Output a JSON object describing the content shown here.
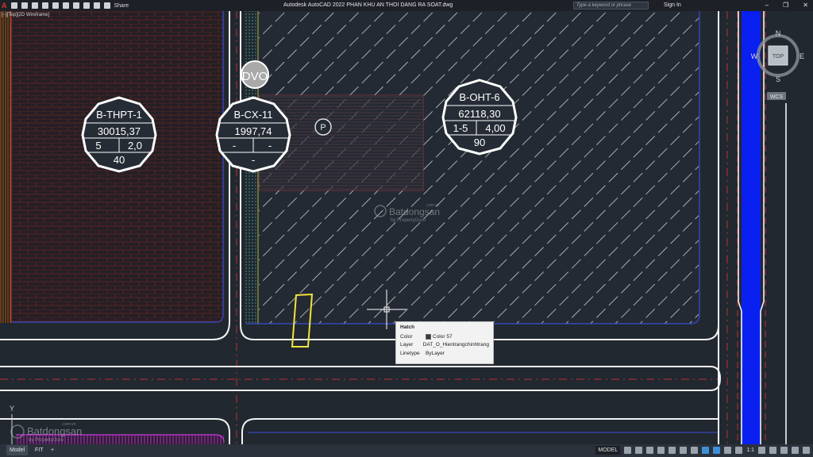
{
  "titlebar": {
    "app_logo": "A",
    "share_label": "Share",
    "title": "Autodesk AutoCAD 2022   PHAN KHU AN THOI DANG RA SOAT.dwg",
    "search_placeholder": "Type a keyword or phrase",
    "sign_in": "Sign In",
    "help": "?"
  },
  "viewport_label": "[−][Top][2D Wireframe]",
  "drawing": {
    "labels": {
      "thpt": {
        "name": "B-THPT-1",
        "area": "30015,37",
        "a": "5",
        "b": "2,0",
        "c": "40"
      },
      "cx": {
        "name": "B-CX-11",
        "area": "1997,74",
        "a": "-",
        "b": "-",
        "c": "-"
      },
      "oht": {
        "name": "B-OHT-6",
        "area": "62118,30",
        "a": "1-5",
        "b": "4,00",
        "c": "90"
      },
      "dvo": "DVO",
      "parking": "P"
    },
    "watermark": {
      "brand": "Batdongsan",
      "sub": "by PropertyGuru",
      "dotcom": ".com.vn"
    },
    "ucs_y": "Y"
  },
  "navcube": {
    "n": "N",
    "s": "S",
    "e": "E",
    "w": "W",
    "face": "TOP",
    "wcs": "WCS"
  },
  "tooltip": {
    "heading": "Hatch",
    "rows": [
      {
        "key": "Color",
        "value": "Color 57"
      },
      {
        "key": "Layer",
        "value": "DAT_O_Hientrangchinhtrang"
      },
      {
        "key": "Linetype",
        "value": "ByLayer"
      }
    ]
  },
  "statusbar": {
    "tabs": [
      "Model",
      "FIT",
      "+"
    ],
    "model_label": "MODEL",
    "scale": "1:1"
  }
}
